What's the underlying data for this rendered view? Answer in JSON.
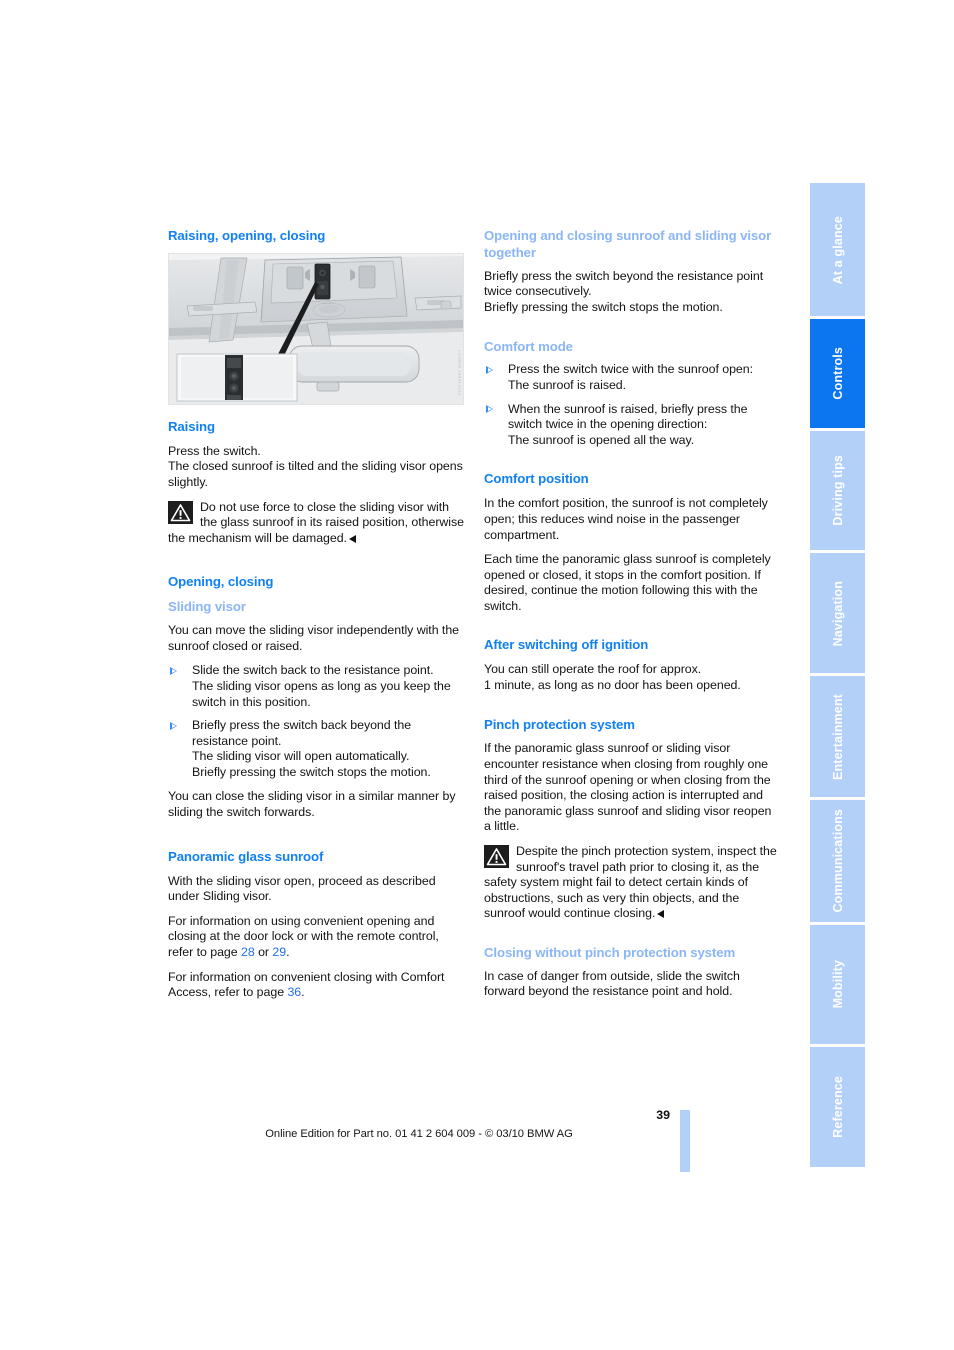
{
  "document": {
    "page_number": "39",
    "footer_text": "Online Edition for Part no. 01 41 2 604 009 - © 03/10 BMW AG"
  },
  "figure": {
    "caption": "LOWER 190914191",
    "alt_name": "overhead-console-sunroof-switch"
  },
  "tabs": [
    {
      "label": "At a glance",
      "active": false
    },
    {
      "label": "Controls",
      "active": true
    },
    {
      "label": "Driving tips",
      "active": false
    },
    {
      "label": "Navigation",
      "active": false
    },
    {
      "label": "Entertainment",
      "active": false
    },
    {
      "label": "Communications",
      "active": false
    },
    {
      "label": "Mobility",
      "active": false
    },
    {
      "label": "Reference",
      "active": false
    }
  ],
  "colors": {
    "heading_blue": "#1180f5",
    "subheading_blue": "#8ab6f7",
    "tab_inactive": "#b3d0f8",
    "tab_active": "#0b76f0",
    "page_ref_blue": "#2370e8"
  },
  "left_column": {
    "heading_main": "Raising, opening, closing",
    "raising": {
      "heading": "Raising",
      "para1_line1": "Press the switch.",
      "para1_line2": "The closed sunroof is tilted and the sliding visor opens slightly.",
      "warning": "Do not use force to close the sliding visor with the glass sunroof in its raised position, otherwise the mechanism will be damaged."
    },
    "opening_closing": {
      "heading": "Opening, closing",
      "sliding_visor_heading": "Sliding visor",
      "intro": "You can move the sliding visor independently with the sunroof closed or raised.",
      "steps": [
        "Slide the switch back to the resistance point.\nThe sliding visor opens as long as you keep the switch in this position.",
        "Briefly press the switch back beyond the resistance point.\nThe sliding visor will open automatically.\nBriefly pressing the switch stops the motion."
      ],
      "closing_note": "You can close the sliding visor in a similar manner by sliding the switch forwards."
    },
    "panoramic": {
      "heading": "Panoramic glass sunroof",
      "para1": "With the sliding visor open, proceed as described under Sliding visor.",
      "para2_a": "For information on using convenient opening and closing at the door lock or with the remote control, refer to page ",
      "para2_ref1": "28",
      "para2_mid": " or ",
      "para2_ref2": "29",
      "para2_end": ".",
      "para3_a": "For information on convenient closing with Comfort Access, refer to page ",
      "para3_ref": "36",
      "para3_end": "."
    }
  },
  "right_column": {
    "together": {
      "heading": "Opening and closing sunroof and sliding visor together",
      "line1": "Briefly press the switch beyond the resistance point twice consecutively.",
      "line2": "Briefly pressing the switch stops the motion."
    },
    "comfort_mode": {
      "heading": "Comfort mode",
      "steps": [
        "Press the switch twice with the sunroof open:\nThe sunroof is raised.",
        "When the sunroof is raised, briefly press the switch twice in the opening direction:\nThe sunroof is opened all the way."
      ]
    },
    "comfort_position": {
      "heading": "Comfort position",
      "para1": "In the comfort position, the sunroof is not completely open; this reduces wind noise in the passenger compartment.",
      "para2": "Each time the panoramic glass sunroof is completely opened or closed, it stops in the comfort position. If desired, continue the motion following this with the switch."
    },
    "after_ignition": {
      "heading": "After switching off ignition",
      "line1": "You can still operate the roof for approx.",
      "line2": "1 minute, as long as no door has been opened."
    },
    "pinch_protection": {
      "heading": "Pinch protection system",
      "para1": "If the panoramic glass sunroof or sliding visor encounter resistance when closing from roughly one third of the sunroof opening or when closing from the raised position, the closing action is interrupted and the panoramic glass sunroof and sliding visor reopen a little.",
      "warning": "Despite the pinch protection system, inspect the sunroof's travel path prior to closing it, as the safety system might fail to detect certain kinds of obstructions, such as very thin objects, and the sunroof would continue closing."
    },
    "closing_without": {
      "heading": "Closing without pinch protection system",
      "para1": "In case of danger from outside, slide the switch forward beyond the resistance point and hold."
    }
  }
}
